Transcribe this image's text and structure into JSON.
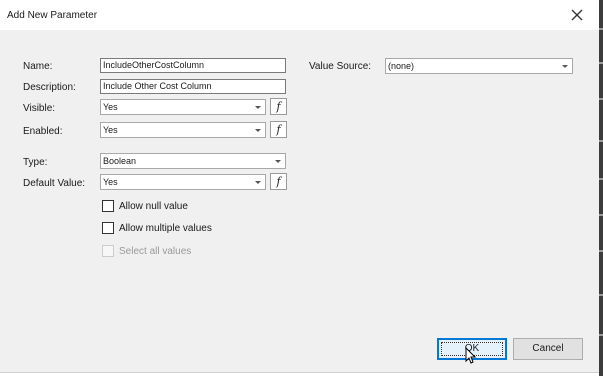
{
  "window": {
    "title": "Add New Parameter",
    "close_icon": "close-icon"
  },
  "form": {
    "name": {
      "label": "Name:",
      "value": "IncludeOtherCostColumn"
    },
    "description": {
      "label": "Description:",
      "value": "Include Other Cost Column"
    },
    "visible": {
      "label": "Visible:",
      "value": "Yes",
      "expression_icon": "f"
    },
    "enabled": {
      "label": "Enabled:",
      "value": "Yes",
      "expression_icon": "f"
    },
    "type": {
      "label": "Type:",
      "value": "Boolean"
    },
    "default_value": {
      "label": "Default Value:",
      "value": "Yes",
      "expression_icon": "f"
    },
    "value_source": {
      "label": "Value Source:",
      "value": "(none)"
    }
  },
  "options": {
    "allow_null": {
      "label": "Allow null value",
      "checked": false,
      "enabled": true
    },
    "allow_multiple": {
      "label": "Allow multiple values",
      "checked": false,
      "enabled": true
    },
    "select_all": {
      "label": "Select all values",
      "checked": false,
      "enabled": false
    }
  },
  "buttons": {
    "ok": "OK",
    "cancel": "Cancel"
  }
}
